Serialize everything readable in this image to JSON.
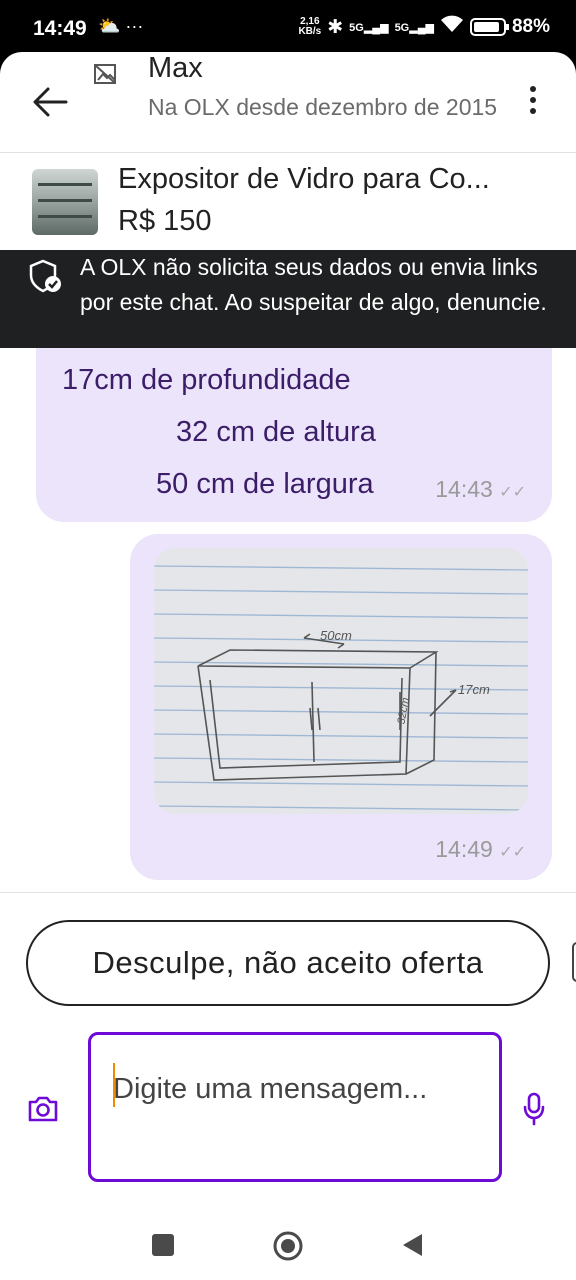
{
  "status_bar": {
    "time": "14:49",
    "left_icons": "⛅ ···",
    "net_speed_value": "2,16",
    "net_speed_unit": "KB/s",
    "signal_1": "5G",
    "signal_2": "5G",
    "battery": "88%"
  },
  "header": {
    "seller_name": "Max",
    "seller_since": "Na OLX desde dezembro de 2015"
  },
  "product": {
    "title": "Expositor de Vidro para Co...",
    "price": "R$ 150"
  },
  "notice": {
    "text": "A OLX não solicita seus dados ou envia links por este chat. Ao suspeitar de algo, denuncie."
  },
  "messages": [
    {
      "lines": [
        "17cm de profundidade",
        "32 cm de altura",
        "50 cm de largura"
      ],
      "time": "14:43"
    },
    {
      "image": {
        "label_width": "50cm",
        "label_depth": "17cm",
        "label_height": "32cm"
      },
      "time": "14:49"
    }
  ],
  "quick_reply": {
    "label": "Desculpe, não aceito oferta"
  },
  "composer": {
    "placeholder": "Digite uma mensagem..."
  },
  "colors": {
    "accent": "#6d0ad6",
    "bubble": "#ece4fb",
    "bubble_text": "#3b1d68",
    "notice_bg": "#1f2021"
  }
}
